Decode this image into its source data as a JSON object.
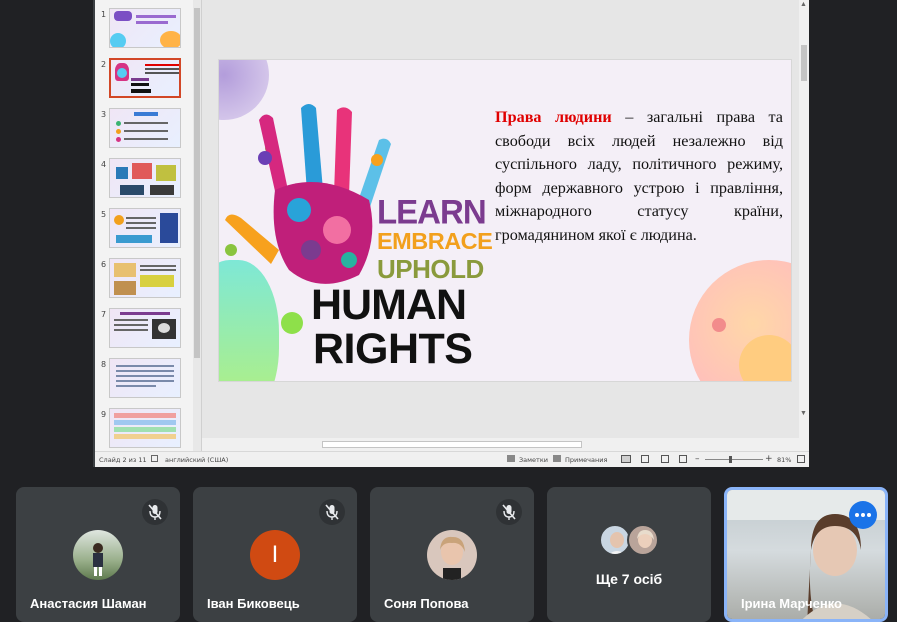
{
  "presentation": {
    "thumbnails": [
      {
        "number": "1",
        "title": "Нуртік: Міжнародний день прав людини"
      },
      {
        "number": "2",
        "title": "HUMAN RIGHTS"
      },
      {
        "number": "3",
        "title": "Принципи"
      },
      {
        "number": "4",
        "title": ""
      },
      {
        "number": "5",
        "title": ""
      },
      {
        "number": "6",
        "title": ""
      },
      {
        "number": "7",
        "title": ""
      },
      {
        "number": "8",
        "title": ""
      },
      {
        "number": "9",
        "title": ""
      }
    ],
    "active_slide": 2,
    "slide": {
      "term": "Права людини",
      "definition": " – загальні права та свободи всіх людей незалежно від суспільного ладу, політичного режиму, форм державного устрою і правління, міжнародного статусу країни, громадянином якої є людина.",
      "art_words": {
        "learn": "LEARN",
        "embrace": "EMBRACE",
        "uphold": "UPHOLD",
        "human": "HUMAN",
        "rights": "RIGHTS"
      }
    },
    "status": {
      "slide_counter": "Слайд 2 из 11",
      "language": "английский (США)",
      "notes": "Заметки",
      "comments": "Примечания",
      "zoom": "81%"
    }
  },
  "participants": [
    {
      "name": "Анастасия Шаман",
      "muted": true
    },
    {
      "name": "Іван Биковець",
      "muted": true,
      "initial": "І"
    },
    {
      "name": "Соня Попова",
      "muted": true
    },
    {
      "label": "Ще 7 осіб"
    },
    {
      "name": "Ірина Марченко",
      "active": true
    }
  ],
  "colors": {
    "background": "#202124",
    "tile": "#3c4043",
    "accent": "#1a73e8",
    "term_red": "#e00000",
    "active_outline": "#8ab4f8"
  }
}
